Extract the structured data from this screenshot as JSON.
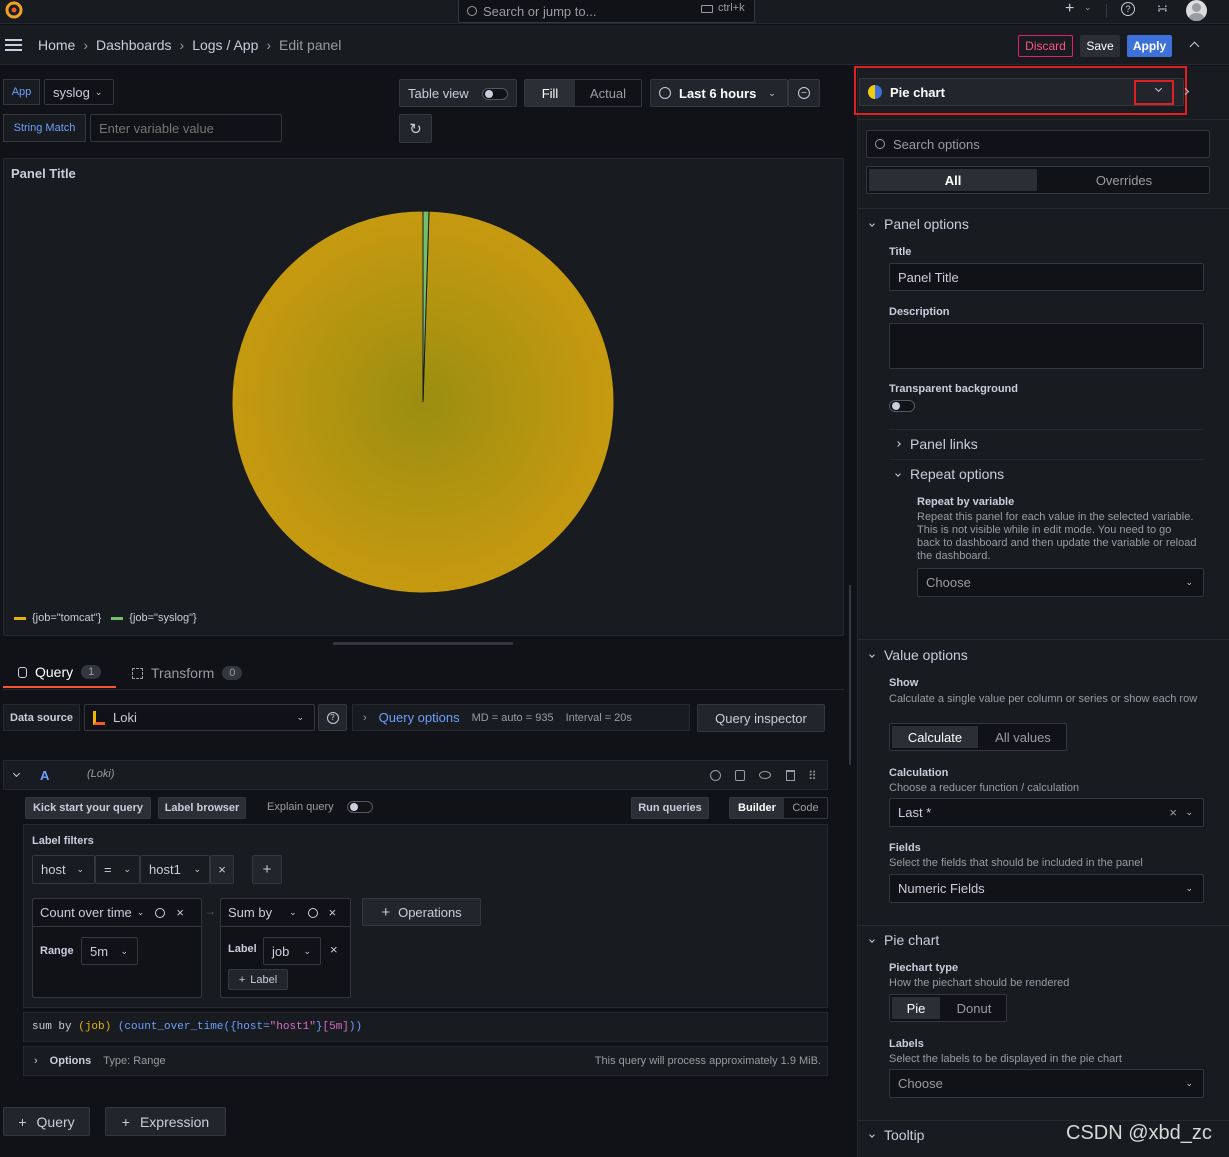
{
  "topbar": {
    "search_placeholder": "Search or jump to...",
    "shortcut": "ctrl+k"
  },
  "breadcrumb": {
    "home": "Home",
    "dashboards": "Dashboards",
    "logs_app": "Logs / App",
    "current": "Edit panel"
  },
  "actions": {
    "discard": "Discard",
    "save": "Save",
    "apply": "Apply"
  },
  "variables": {
    "app_label": "App",
    "app_value": "syslog",
    "string_match_label": "String Match",
    "string_match_placeholder": "Enter variable value"
  },
  "toolbar": {
    "table_view": "Table view",
    "fill": "Fill",
    "actual": "Actual",
    "time_range": "Last 6 hours"
  },
  "panel": {
    "title": "Panel Title",
    "legend": [
      "{job=\"tomcat\"}",
      "{job=\"syslog\"}"
    ]
  },
  "chart_data": {
    "type": "pie",
    "title": "Panel Title",
    "series": [
      {
        "name": "{job=\"tomcat\"}",
        "value": 99.5,
        "color": "#c79a10"
      },
      {
        "name": "{job=\"syslog\"}",
        "value": 0.5,
        "color": "#73bf69"
      }
    ]
  },
  "query_tabs": {
    "query": "Query",
    "query_count": "1",
    "transform": "Transform",
    "transform_count": "0"
  },
  "datasource": {
    "label": "Data source",
    "value": "Loki",
    "query_options": "Query options",
    "md": "MD = auto = 935",
    "interval": "Interval = 20s",
    "inspector": "Query inspector"
  },
  "query_a": {
    "letter": "A",
    "ds": "(Loki)",
    "kick_start": "Kick start your query",
    "label_browser": "Label browser",
    "explain": "Explain query",
    "run": "Run queries",
    "builder": "Builder",
    "code": "Code",
    "label_filters": "Label filters",
    "filter_key": "host",
    "filter_op": "=",
    "filter_value": "host1",
    "op1_name": "Count over time",
    "op1_range_label": "Range",
    "op1_range": "5m",
    "op2_name": "Sum by",
    "op2_label_label": "Label",
    "op2_label": "job",
    "op2_add_label": "Label",
    "operations": "Operations",
    "options_label": "Options",
    "options_type": "Type: Range",
    "process_note": "This query will process approximately 1.9 MiB."
  },
  "code_tokens": [
    "sum by ",
    "(job)",
    " (count_over_time(",
    "{host=",
    "\"host1\"",
    "}",
    "[5m]",
    "))"
  ],
  "bottom": {
    "add_query": "Query",
    "add_expression": "Expression"
  },
  "options_pane": {
    "viz": "Pie chart",
    "search_placeholder": "Search options",
    "tab_all": "All",
    "tab_overrides": "Overrides",
    "panel_options": "Panel options",
    "title_label": "Title",
    "title_value": "Panel Title",
    "description_label": "Description",
    "transparent_label": "Transparent background",
    "panel_links": "Panel links",
    "repeat_options": "Repeat options",
    "repeat_by": "Repeat by variable",
    "repeat_desc": "Repeat this panel for each value in the selected variable. This is not visible while in edit mode. You need to go back to dashboard and then update the variable or reload the dashboard.",
    "repeat_choose": "Choose",
    "value_options": "Value options",
    "show_label": "Show",
    "show_desc": "Calculate a single value per column or series or show each row",
    "show_calculate": "Calculate",
    "show_all": "All values",
    "calculation_label": "Calculation",
    "calculation_desc": "Choose a reducer function / calculation",
    "calculation_value": "Last *",
    "fields_label": "Fields",
    "fields_desc": "Select the fields that should be included in the panel",
    "fields_value": "Numeric Fields",
    "pie_section": "Pie chart",
    "piechart_type_label": "Piechart type",
    "piechart_type_desc": "How the piechart should be rendered",
    "pie": "Pie",
    "donut": "Donut",
    "labels_label": "Labels",
    "labels_desc": "Select the labels to be displayed in the pie chart",
    "labels_choose": "Choose",
    "tooltip": "Tooltip"
  },
  "watermark": "CSDN @xbd_zc"
}
